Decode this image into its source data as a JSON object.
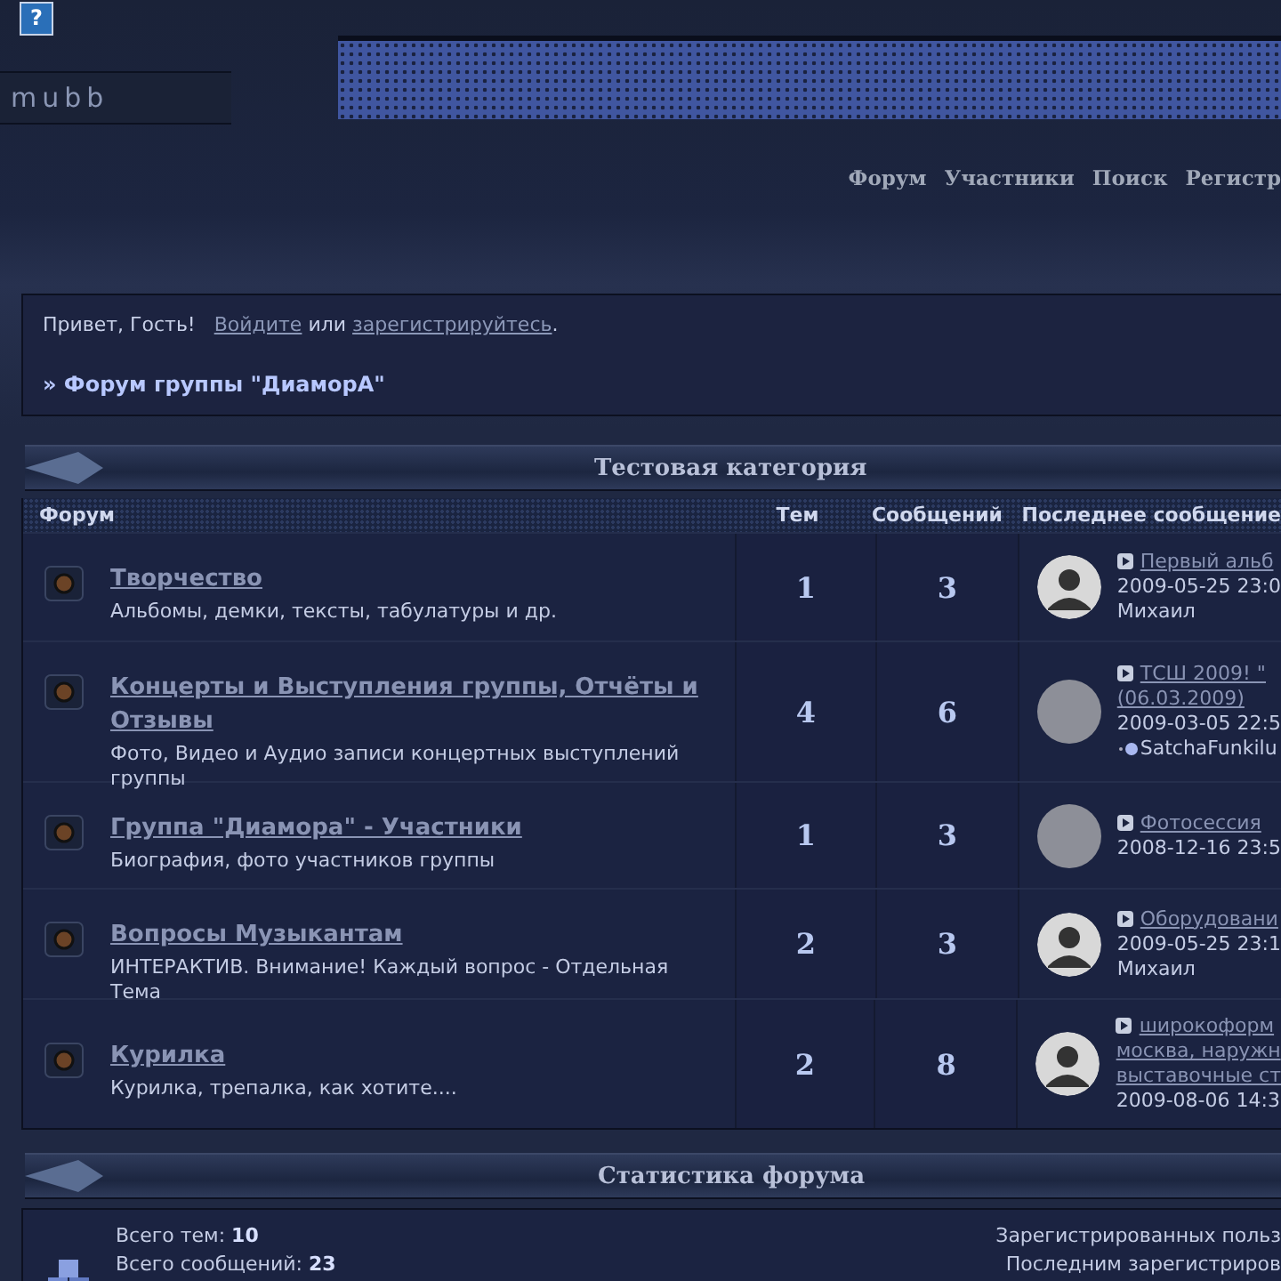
{
  "header": {
    "help_icon": "?",
    "logo": "mubb"
  },
  "nav": [
    "Форум",
    "Участники",
    "Поиск",
    "Регистр"
  ],
  "welcome": {
    "greeting": "Привет, Гость!",
    "login_link": "Войдите",
    "or": "или",
    "register_link": "зарегистрируйтесь",
    "end": "."
  },
  "breadcrumb": "» Форум группы \"ДиаморА\"",
  "category": {
    "title": "Тестовая категория",
    "columns": [
      "Форум",
      "Тем",
      "Сообщений",
      "Последнее сообщение"
    ],
    "forums": [
      {
        "name": "Творчество",
        "description": "Альбомы, демки, тексты, табулатуры и др.",
        "topics": "1",
        "posts": "3",
        "last": {
          "kind": "default",
          "title": [
            "Первый альб"
          ],
          "date": "2009-05-25 23:0",
          "author": "Михаил",
          "author_dot": false
        }
      },
      {
        "name": "Концерты и Выступления группы, Отчёты и Отзывы",
        "description": "Фото, Видео и Аудио записи концертных выступлений группы",
        "topics": "4",
        "posts": "6",
        "last": {
          "kind": "photo",
          "title": [
            "ТСШ 2009! \"",
            "(06.03.2009)"
          ],
          "date": "2009-03-05 22:5",
          "author": "SatchaFunkilu",
          "author_dot": true
        }
      },
      {
        "name": "Группа \"Диамора\" - Участники",
        "description": "Биография, фото участников группы",
        "topics": "1",
        "posts": "3",
        "last": {
          "kind": "photo",
          "title": [
            "Фотосессия"
          ],
          "date": "2008-12-16 23:5"
        }
      },
      {
        "name": "Вопросы Музыкантам",
        "description": "ИНТЕРАКТИВ. Внимание! Каждый вопрос - Отдельная Тема",
        "topics": "2",
        "posts": "3",
        "last": {
          "kind": "default",
          "title": [
            "Оборудовани"
          ],
          "date": "2009-05-25 23:1",
          "author": "Михаил",
          "author_dot": false
        }
      },
      {
        "name": "Курилка",
        "description": "Курилка, трепалка, как хотите....",
        "topics": "2",
        "posts": "8",
        "last": {
          "kind": "default",
          "title": [
            "широкоформ",
            "москва, наружн",
            "выставочные ст"
          ],
          "date": "2009-08-06 14:3"
        }
      }
    ]
  },
  "stats": {
    "title": "Статистика форума",
    "left": [
      {
        "label": "Всего тем:",
        "value": "10"
      },
      {
        "label": "Всего сообщений:",
        "value": "23"
      }
    ],
    "right": [
      "Зарегистрированных польз",
      "Последним зарегистриров"
    ]
  }
}
